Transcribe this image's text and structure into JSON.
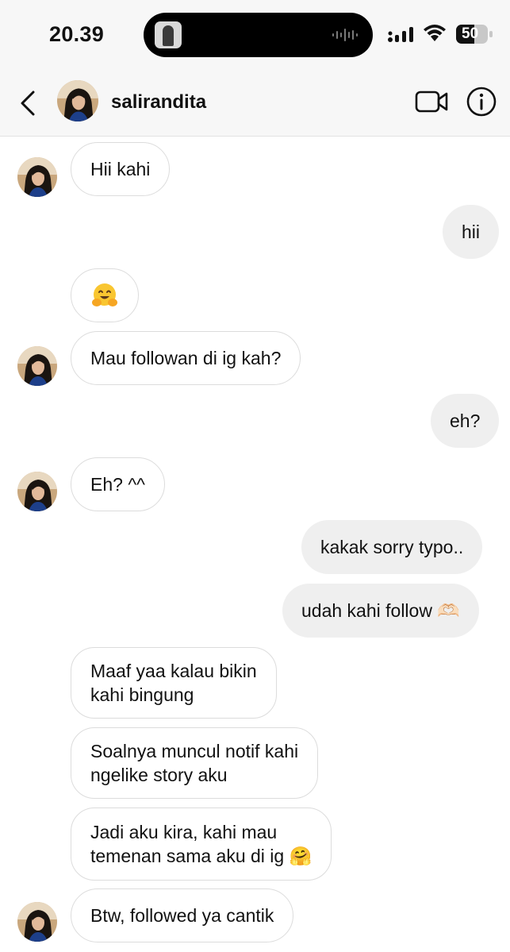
{
  "status_bar": {
    "time": "20.39",
    "battery_level": "50",
    "icons": [
      "signal-icon",
      "wifi-icon",
      "battery-icon"
    ]
  },
  "header": {
    "username": "salirandita",
    "icons": [
      "back-icon",
      "video-call-icon",
      "info-icon"
    ]
  },
  "messages": [
    {
      "sender": "them",
      "text": "Hii kahi"
    },
    {
      "sender": "me",
      "text": "hii"
    },
    {
      "sender": "them",
      "text": "🤗"
    },
    {
      "sender": "them",
      "text": "Mau followan di ig kah?"
    },
    {
      "sender": "me",
      "text": "eh?"
    },
    {
      "sender": "them",
      "text": "Eh? ^^"
    },
    {
      "sender": "me",
      "text": "kakak sorry typo.."
    },
    {
      "sender": "me",
      "text": "udah kahi follow 🫶🏻"
    },
    {
      "sender": "them",
      "lines": [
        "Maaf yaa kalau bikin",
        "kahi bingung"
      ]
    },
    {
      "sender": "them",
      "lines": [
        "Soalnya muncul notif kahi",
        "ngelike story aku"
      ]
    },
    {
      "sender": "them",
      "lines": [
        "Jadi aku kira, kahi mau",
        "temenan sama aku di ig 🤗"
      ]
    },
    {
      "sender": "them",
      "text": "Btw, followed ya cantik"
    }
  ],
  "colors": {
    "incoming_bubble_border": "#dcdcdc",
    "outgoing_bubble_bg": "#efefef",
    "header_bg": "#f7f7f7"
  }
}
